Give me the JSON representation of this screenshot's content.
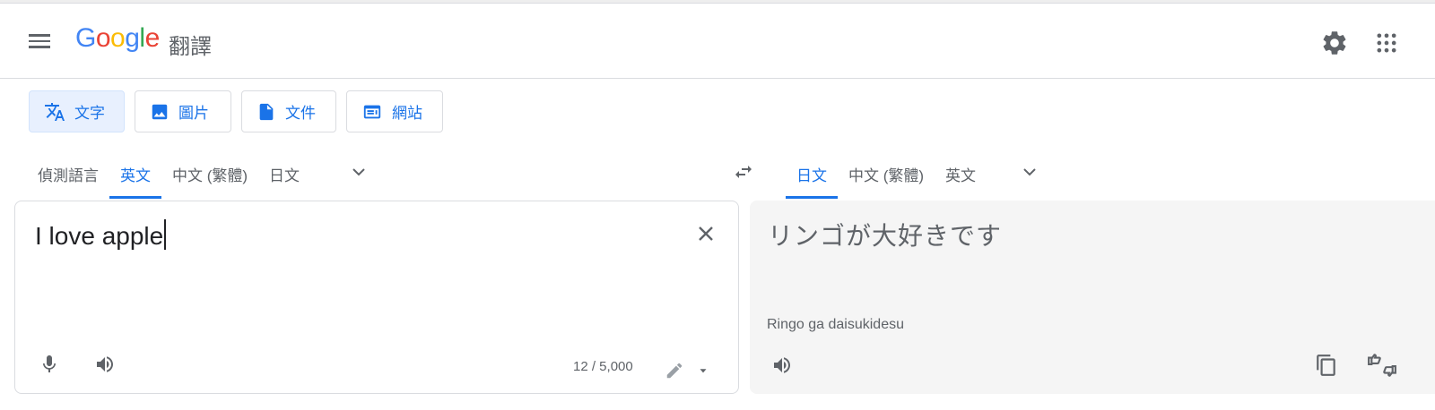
{
  "header": {
    "logo_letters": [
      "G",
      "o",
      "o",
      "g",
      "l",
      "e"
    ],
    "product_name": "翻譯"
  },
  "modes": [
    {
      "label": "文字",
      "icon": "translate-icon",
      "active": true
    },
    {
      "label": "圖片",
      "icon": "image-icon",
      "active": false
    },
    {
      "label": "文件",
      "icon": "document-icon",
      "active": false
    },
    {
      "label": "網站",
      "icon": "website-icon",
      "active": false
    }
  ],
  "source_languages": [
    "偵測語言",
    "英文",
    "中文 (繁體)",
    "日文"
  ],
  "source_active": "英文",
  "target_languages": [
    "日文",
    "中文 (繁體)",
    "英文"
  ],
  "target_active": "日文",
  "source": {
    "text": "I love apple",
    "char_count": "12 / 5,000"
  },
  "target": {
    "text": "リンゴが大好きです",
    "romanization": "Ringo ga daisukidesu"
  },
  "colors": {
    "accent": "#1a73e8",
    "active_tab_bg": "#e8f0fe",
    "target_panel_bg": "#f5f5f5"
  }
}
